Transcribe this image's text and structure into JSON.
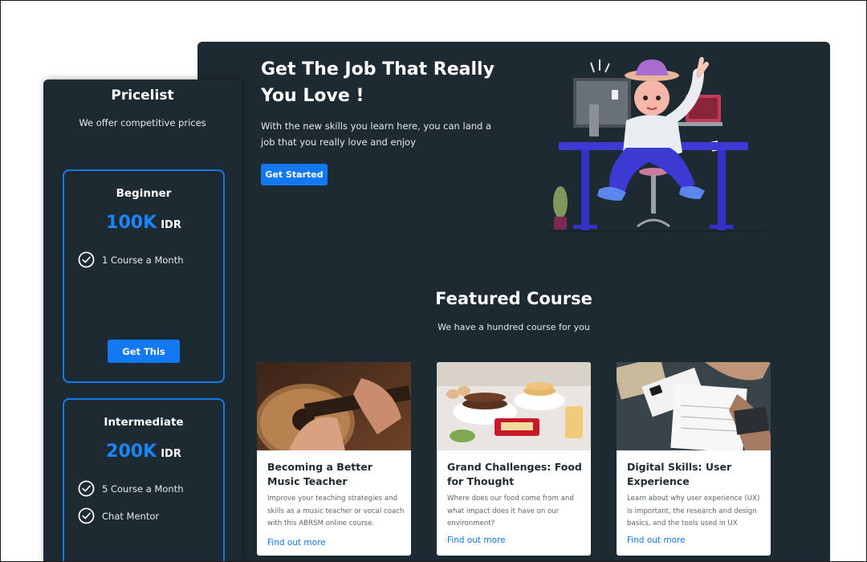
{
  "hero": {
    "title": "Get The Job That Really You Love !",
    "description": "With the new skills you learn here, you can land a job that you really love and enjoy",
    "cta_label": "Get Started"
  },
  "featured": {
    "title": "Featured Course",
    "subtitle": "We have a hundred course for you",
    "courses": [
      {
        "title": "Becoming a Better Music Teacher",
        "description": "Improve your teaching strategies and skills as a music teacher or vocal coach with this ABRSM online course.",
        "link": "Find out more",
        "image_icon": "guitar-photo"
      },
      {
        "title": "Grand Challenges: Food for Thought",
        "description": "Where does our food come from and what impact does it have on our environment?",
        "link": "Find out more",
        "image_icon": "breakfast-photo"
      },
      {
        "title": "Digital Skills: User Experience",
        "description": "Learn about why user experience (UX) is important, the research and design basics, and the tools used in UX",
        "link": "Find out more",
        "image_icon": "desk-photo"
      }
    ]
  },
  "pricelist": {
    "title": "Pricelist",
    "subtitle": "We offer competitive prices",
    "plans": [
      {
        "name": "Beginner",
        "price": "100K",
        "currency": "IDR",
        "features": [
          "1 Course a Month"
        ],
        "button": "Get This"
      },
      {
        "name": "Intermediate",
        "price": "200K",
        "currency": "IDR",
        "features": [
          "5 Course a Month",
          "Chat Mentor"
        ]
      }
    ]
  },
  "colors": {
    "panel_bg": "#1e2a32",
    "accent": "#1279f2",
    "page_bg": "#ffffff"
  },
  "icons": {
    "feature": "check-circle-icon",
    "hero_art": "developer-at-desk-illustration"
  }
}
